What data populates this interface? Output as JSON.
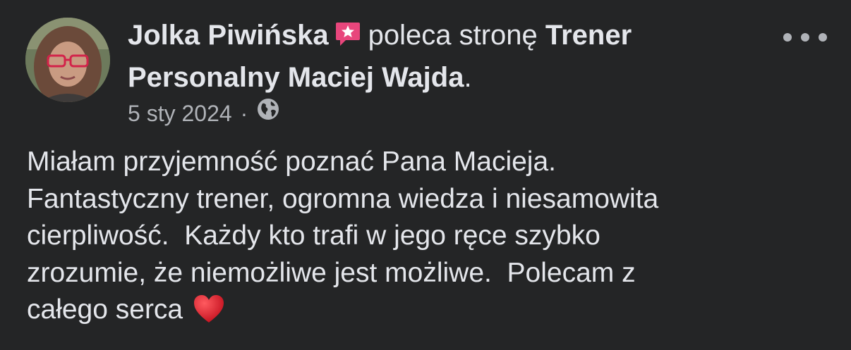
{
  "post": {
    "author_name": "Jolka Piwińska",
    "action_text": "poleca stronę",
    "page_name_line1": "Trener",
    "page_name_line2": "Personalny Maciej Wajda",
    "page_name_suffix": ".",
    "date": "5 sty 2024",
    "separator": "·",
    "audience_icon": "globe-icon",
    "recommend_badge_icon": "recommendation-star-icon",
    "more_icon": "more-options-icon",
    "body_lines": [
      "Miałam przyjemność poznać Pana Macieja.",
      "Fantastyczny trener, ogromna wiedza i niesamowita",
      "cierpliwość.  Każdy kto trafi w jego ręce szybko",
      "zrozumie, że niemożliwe jest możliwe.  Polecam z",
      "całego serca"
    ],
    "body_emoji": "heart-emoji-icon"
  },
  "colors": {
    "background": "#242526",
    "primary_text": "#e4e6eb",
    "secondary_text": "#b0b3b8",
    "badge_pink": "#e8467c",
    "heart_red": "#d81b2a"
  }
}
